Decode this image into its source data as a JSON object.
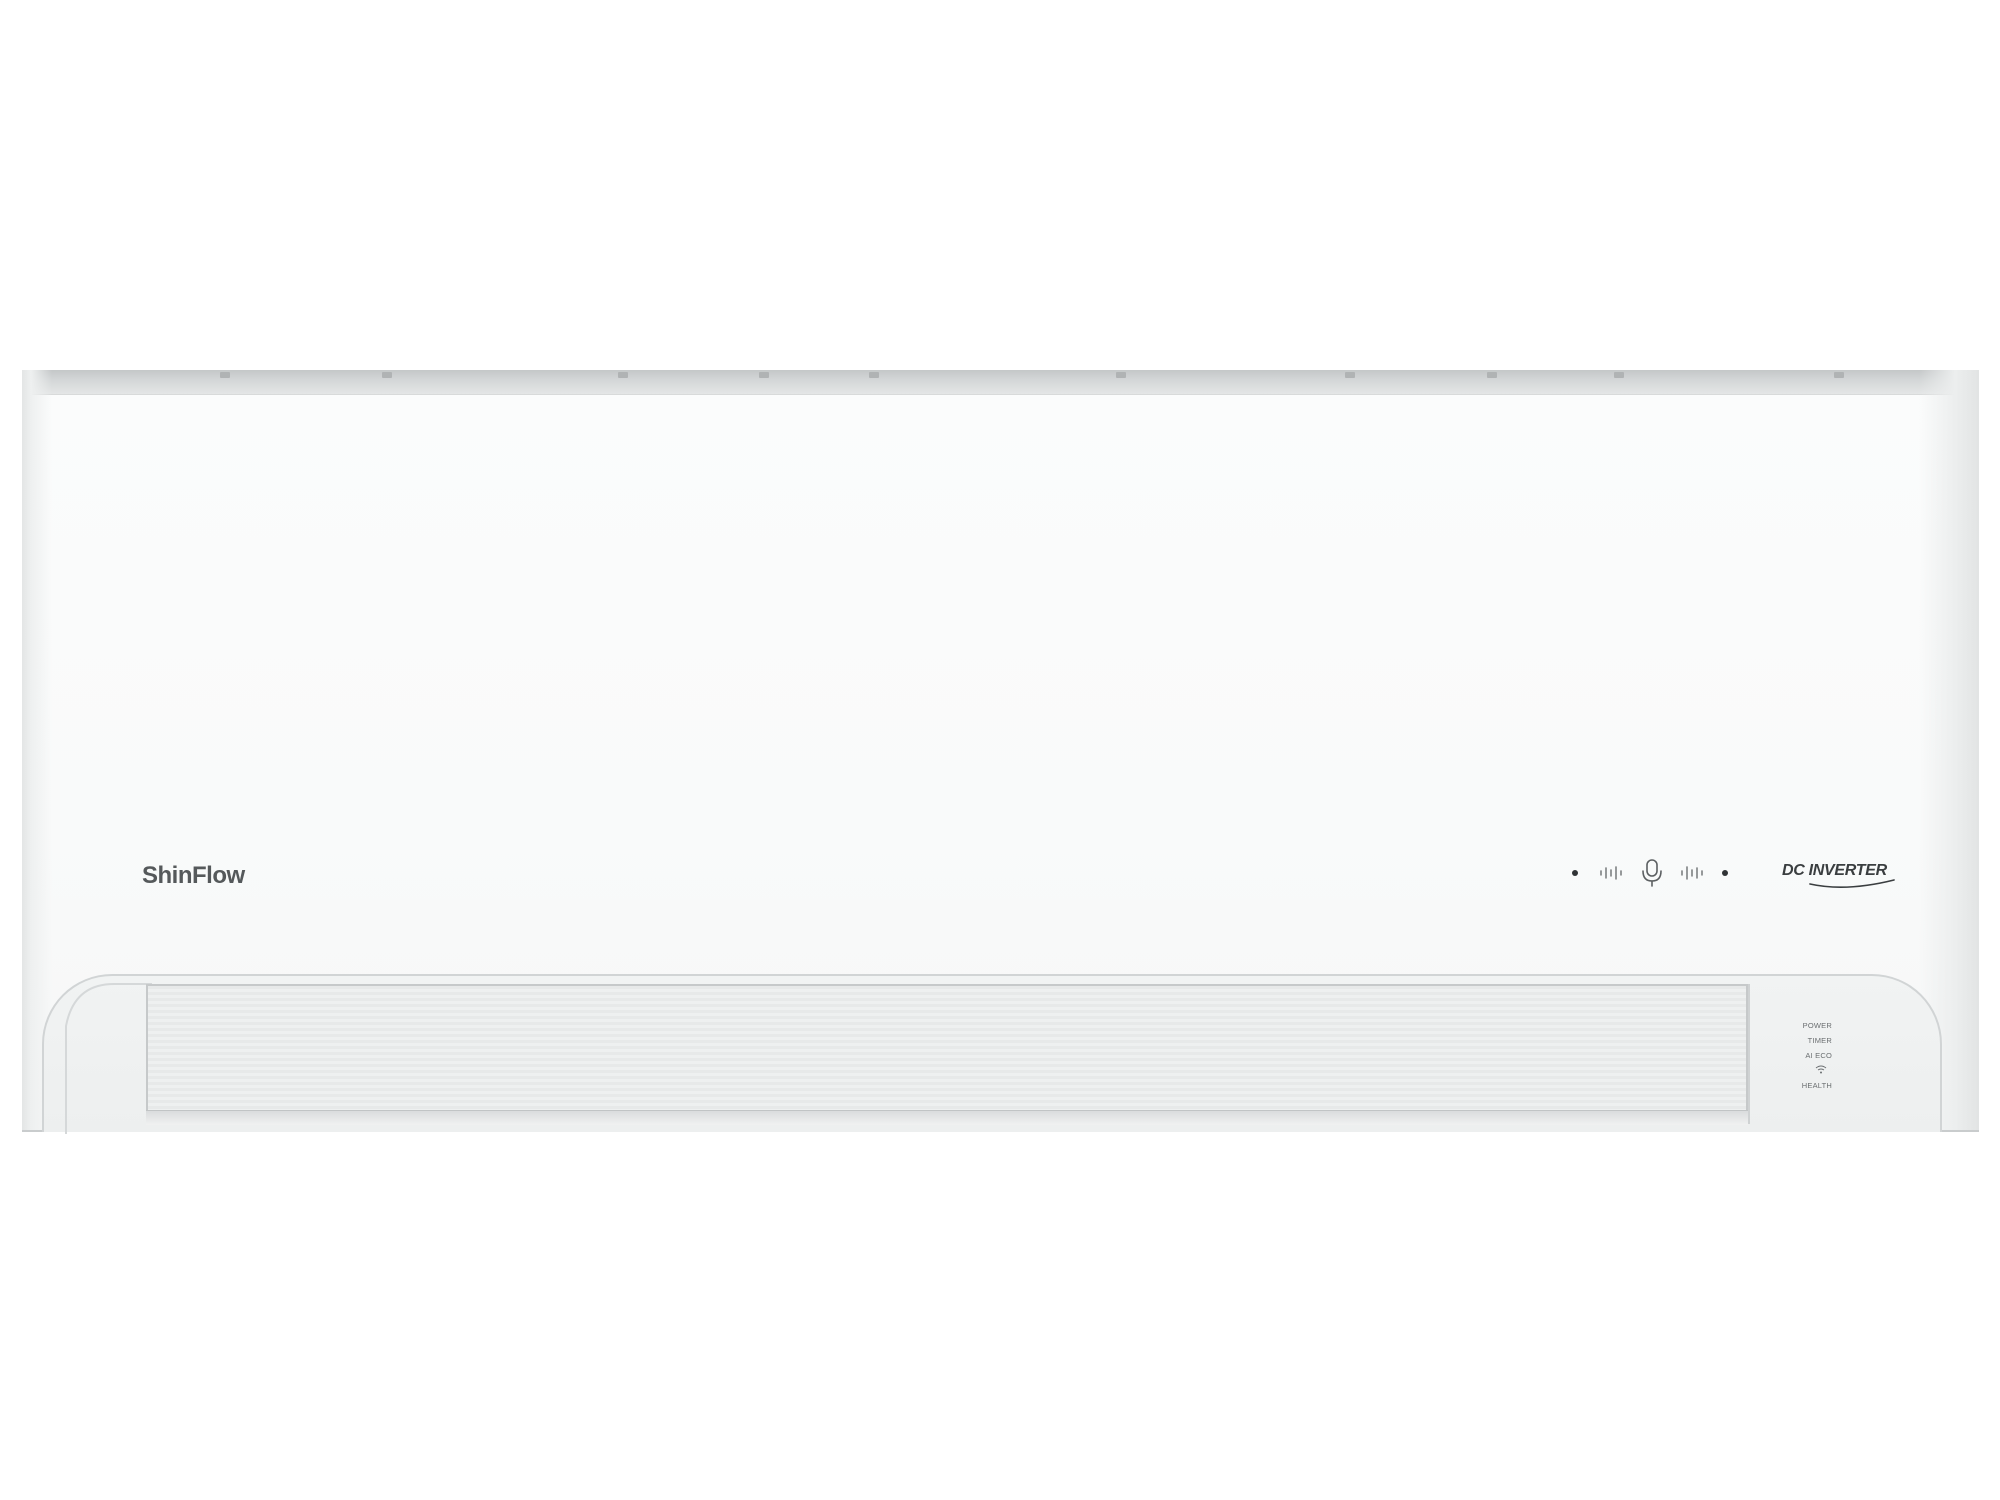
{
  "product": {
    "brand": "ShinFlow",
    "badge": "DC INVERTER"
  },
  "colors": {
    "body": "#f9fafa",
    "trim": "#c9cccd",
    "logo_text": "#55595b",
    "badge_text": "#3a3e40"
  },
  "front_panel": {
    "voice_icons": [
      "dot-icon",
      "sound-wave-icon",
      "microphone-icon",
      "sound-wave-icon",
      "dot-icon"
    ]
  },
  "indicators": [
    {
      "label": "POWER",
      "icon": ""
    },
    {
      "label": "TIMER",
      "icon": ""
    },
    {
      "label": "AI ECO",
      "icon": ""
    },
    {
      "label": "",
      "icon": "wifi-icon"
    },
    {
      "label": "HEALTH",
      "icon": ""
    }
  ]
}
